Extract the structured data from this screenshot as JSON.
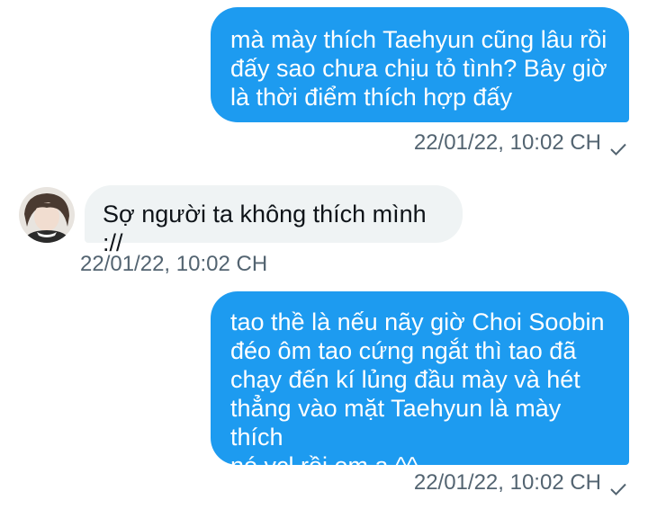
{
  "messages": [
    {
      "direction": "sent",
      "text": "mà mày thích Taehyun cũng lâu rồi\nđấy sao chưa chịu tỏ tình? Bây giờ\nlà thời điểm thích hợp đấy",
      "timestamp": "22/01/22, 10:02 CH",
      "status_icon": "check-icon"
    },
    {
      "direction": "received",
      "text": "Sợ người ta không thích mình ://",
      "timestamp": "22/01/22, 10:02 CH",
      "avatar_icon": "avatar"
    },
    {
      "direction": "sent",
      "text": "tao thề là nếu nãy giờ Choi Soobin\nđéo ôm tao cứng ngắt thì tao đã\nchạy đến kí lủng đầu mày và hét\nthẳng vào mặt Taehyun là mày thích\nnó vcl rồi em ạ ^^",
      "timestamp": "22/01/22, 10:02 CH",
      "status_icon": "check-icon"
    }
  ],
  "colors": {
    "sent_bubble": "#1d9bf0",
    "received_bubble": "#eff3f4",
    "timestamp": "#536471"
  }
}
